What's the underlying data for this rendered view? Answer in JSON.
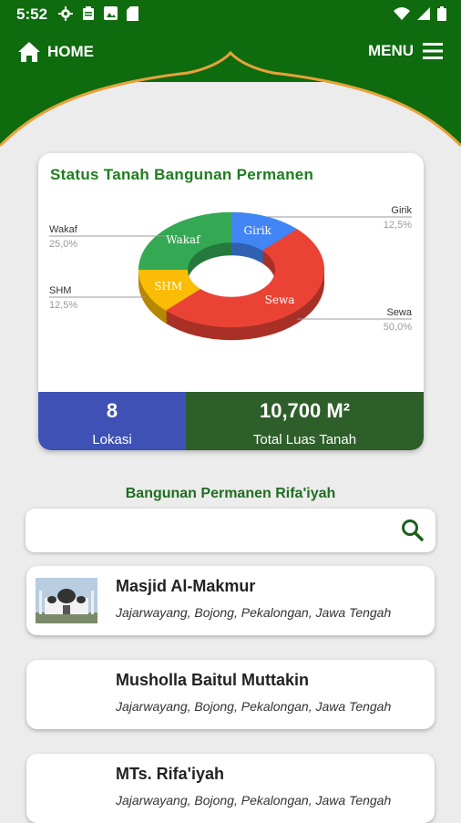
{
  "status_bar": {
    "time": "5:52"
  },
  "nav": {
    "home_label": "HOME",
    "menu_label": "MENU"
  },
  "card": {
    "title": "Status Tanah Bangunan Permanen",
    "lokasi_count": "8",
    "lokasi_label": "Lokasi",
    "luas_value": "10,700 M²",
    "luas_label": "Total Luas Tanah"
  },
  "chart_data": {
    "type": "pie",
    "slices": [
      {
        "name": "Girik",
        "value": 12.5,
        "percent_label": "12,5%",
        "color": "#4285f4"
      },
      {
        "name": "Sewa",
        "value": 50.0,
        "percent_label": "50,0%",
        "color": "#ea4335"
      },
      {
        "name": "SHM",
        "value": 12.5,
        "percent_label": "12,5%",
        "color": "#fbbc05"
      },
      {
        "name": "Wakaf",
        "value": 25.0,
        "percent_label": "25,0%",
        "color": "#34a853"
      }
    ]
  },
  "list": {
    "title": "Bangunan Permanen Rifa'iyah",
    "search_placeholder": "",
    "items": [
      {
        "name": "Masjid Al-Makmur",
        "address": "Jajarwayang, Bojong, Pekalongan, Jawa Tengah"
      },
      {
        "name": "Musholla Baitul Muttakin",
        "address": "Jajarwayang, Bojong, Pekalongan, Jawa Tengah"
      },
      {
        "name": "MTs. Rifa'iyah",
        "address": "Jajarwayang, Bojong, Pekalongan, Jawa Tengah"
      }
    ]
  },
  "colors": {
    "primary_green": "#0e6b0e",
    "blue_stat": "#3f51b5",
    "dark_green_stat": "#2e5e2a"
  }
}
